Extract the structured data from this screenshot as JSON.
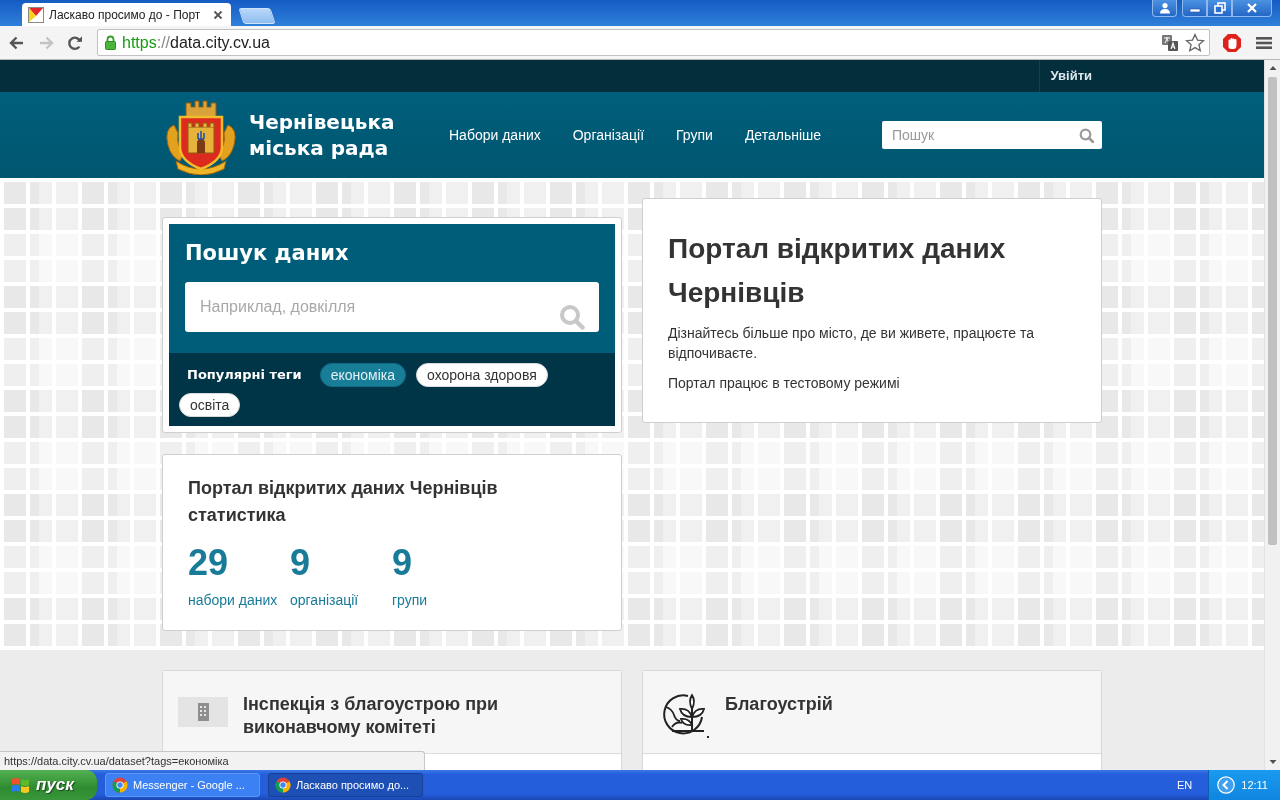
{
  "browser": {
    "tab": {
      "title": "Ласкаво просимо до - Порт"
    },
    "nav_buttons": [
      {
        "kind": "back",
        "disabled": false
      },
      {
        "kind": "forward",
        "disabled": true
      },
      {
        "kind": "reload",
        "disabled": false
      }
    ],
    "address": {
      "scheme": "https",
      "separator": "://",
      "host": "data.city.cv.ua"
    }
  },
  "site": {
    "login": "Увійти",
    "brand": "Чернівецька міська рада",
    "nav": [
      "Набори даних",
      "Організації",
      "Групи",
      "Детальніше"
    ],
    "search": {
      "placeholder": "Пошук"
    }
  },
  "search_module": {
    "title": "Пошук даних",
    "placeholder": "Наприклад, довкілля",
    "tags_label": "Популярні теги",
    "tags": [
      {
        "label": "економіка",
        "hovered": true
      },
      {
        "label": "охорона здоровя",
        "hovered": false
      },
      {
        "label": "освіта",
        "hovered": false
      }
    ]
  },
  "stats": {
    "title": "Портал відкритих даних Чернівців статистика",
    "items": [
      {
        "value": "29",
        "label": "набори даних"
      },
      {
        "value": "9",
        "label": "організації"
      },
      {
        "value": "9",
        "label": "групи"
      }
    ]
  },
  "intro": {
    "title": "Портал відкритих даних Чернівців",
    "paragraphs": [
      "Дізнайтесь більше про місто, де ви живете, працюєте та відпочиваєте.",
      "Портал працює в тестовому режимі"
    ]
  },
  "featured": [
    {
      "kind": "organization",
      "title": "Інспекція з благоустрою при виконавчому комітеті"
    },
    {
      "kind": "group",
      "title": "Благоустрій"
    }
  ],
  "status_bubble": "https://data.city.cv.ua/dataset?tags=економіка",
  "taskbar": {
    "start": "пуск",
    "items": [
      {
        "label": "Messenger - Google ...",
        "selected": false
      },
      {
        "label": "Ласкаво просимо до...",
        "selected": true
      }
    ],
    "language": "EN",
    "clock": "12:11"
  }
}
